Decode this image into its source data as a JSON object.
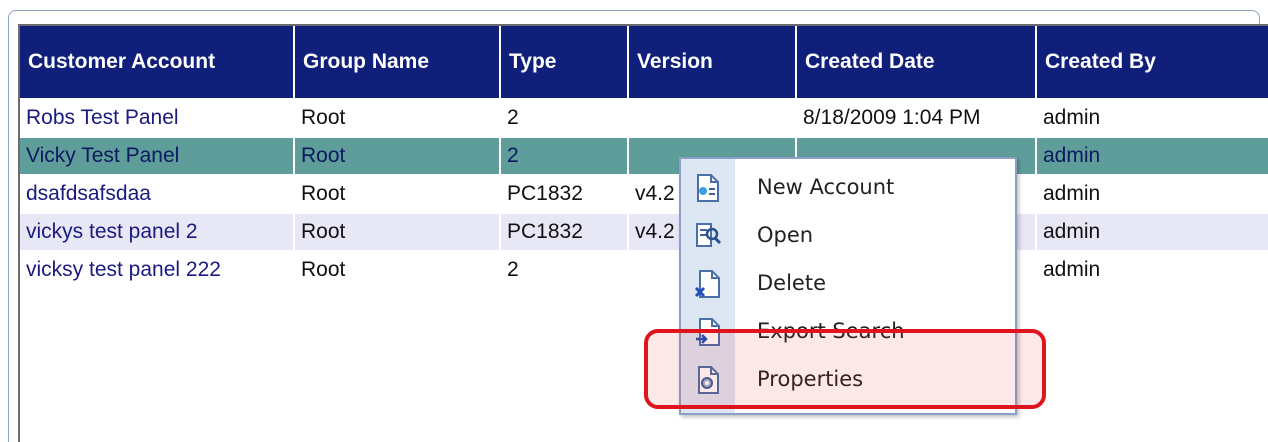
{
  "columns": [
    "Customer Account",
    "Group Name",
    "Type",
    "Version",
    "Created Date",
    "Created By"
  ],
  "rows": [
    {
      "customer": "Robs Test Panel",
      "group": "Root",
      "type": "2",
      "version": "",
      "created": "8/18/2009 1:04 PM",
      "by": "admin"
    },
    {
      "customer": "Vicky Test Panel",
      "group": "Root",
      "type": "2",
      "version": "",
      "created": "",
      "by": "admin"
    },
    {
      "customer": "dsafdsafsdaa",
      "group": "Root",
      "type": "PC1832",
      "version": "v4.2",
      "created": "",
      "by": "admin"
    },
    {
      "customer": "vickys test panel 2",
      "group": "Root",
      "type": "PC1832",
      "version": "v4.2",
      "created": "",
      "by": "admin"
    },
    {
      "customer": "vicksy test panel 222",
      "group": "Root",
      "type": "2",
      "version": "",
      "created": "",
      "by": "admin"
    }
  ],
  "context_menu": {
    "items": [
      {
        "label": "New Account",
        "icon": "new-account-icon"
      },
      {
        "label": "Open",
        "icon": "open-icon"
      },
      {
        "label": "Delete",
        "icon": "delete-icon"
      },
      {
        "label": "Export Search",
        "icon": "export-icon"
      },
      {
        "label": "Properties",
        "icon": "properties-icon"
      }
    ]
  },
  "colors": {
    "header_bg": "#0f1f7a",
    "selected_row": "#5f9d9b",
    "alt_row": "#e7e7f6",
    "highlight_border": "#e0141c"
  }
}
